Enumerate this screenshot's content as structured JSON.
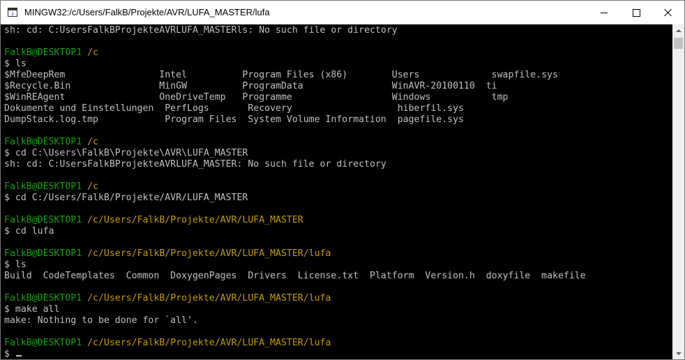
{
  "window": {
    "title": "MINGW32:/c/Users/FalkB/Projekte/AVR/LUFA_MASTER/lufa",
    "icon": "terminal-icon",
    "controls": {
      "minimize": "minimize-icon",
      "maximize": "maximize-icon",
      "close": "close-icon"
    }
  },
  "colors": {
    "prompt_user": "#13a10e",
    "prompt_path": "#c19c00",
    "text": "#c0c0c0",
    "background": "#000000"
  },
  "terminal": {
    "lines": [
      {
        "type": "out",
        "text": "sh: cd: C:UsersFalkBProjekteAVRLUFA_MASTERls: No such file or directory"
      },
      {
        "type": "blank",
        "text": ""
      },
      {
        "type": "prompt",
        "user": "FalkB@DESKTOP1",
        "path": "/c"
      },
      {
        "type": "out",
        "text": "$ ls"
      },
      {
        "type": "out",
        "text": "$MfeDeepRem                 Intel          Program Files (x86)        Users             swapfile.sys"
      },
      {
        "type": "out",
        "text": "$Recycle.Bin                MinGW          ProgramData                WinAVR-20100110  ti"
      },
      {
        "type": "out",
        "text": "$WinREAgent                 OneDriveTemp   Programme                  Windows           tmp"
      },
      {
        "type": "out",
        "text": "Dokumente und Einstellungen  PerfLogs       Recovery                   hiberfil.sys"
      },
      {
        "type": "out",
        "text": "DumpStack.log.tmp            Program Files  System Volume Information  pagefile.sys"
      },
      {
        "type": "blank",
        "text": ""
      },
      {
        "type": "prompt",
        "user": "FalkB@DESKTOP1",
        "path": "/c"
      },
      {
        "type": "out",
        "text": "$ cd C:\\Users\\FalkB\\Projekte\\AVR\\LUFA_MASTER"
      },
      {
        "type": "out",
        "text": "sh: cd: C:UsersFalkBProjekteAVRLUFA_MASTER: No such file or directory"
      },
      {
        "type": "blank",
        "text": ""
      },
      {
        "type": "prompt",
        "user": "FalkB@DESKTOP1",
        "path": "/c"
      },
      {
        "type": "out",
        "text": "$ cd C:/Users/FalkB/Projekte/AVR/LUFA_MASTER"
      },
      {
        "type": "blank",
        "text": ""
      },
      {
        "type": "prompt",
        "user": "FalkB@DESKTOP1",
        "path": "/c/Users/FalkB/Projekte/AVR/LUFA_MASTER"
      },
      {
        "type": "out",
        "text": "$ cd lufa"
      },
      {
        "type": "blank",
        "text": ""
      },
      {
        "type": "prompt",
        "user": "FalkB@DESKTOP1",
        "path": "/c/Users/FalkB/Projekte/AVR/LUFA_MASTER/lufa"
      },
      {
        "type": "out",
        "text": "$ ls"
      },
      {
        "type": "out",
        "text": "Build  CodeTemplates  Common  DoxygenPages  Drivers  License.txt  Platform  Version.h  doxyfile  makefile"
      },
      {
        "type": "blank",
        "text": ""
      },
      {
        "type": "prompt",
        "user": "FalkB@DESKTOP1",
        "path": "/c/Users/FalkB/Projekte/AVR/LUFA_MASTER/lufa"
      },
      {
        "type": "out",
        "text": "$ make all"
      },
      {
        "type": "out",
        "text": "make: Nothing to be done for `all'."
      },
      {
        "type": "blank",
        "text": ""
      },
      {
        "type": "prompt",
        "user": "FalkB@DESKTOP1",
        "path": "/c/Users/FalkB/Projekte/AVR/LUFA_MASTER/lufa"
      },
      {
        "type": "input",
        "text": "$ "
      }
    ]
  },
  "scrollbar": {
    "up_icon": "scroll-up-arrow-icon",
    "down_icon": "scroll-down-arrow-icon"
  }
}
